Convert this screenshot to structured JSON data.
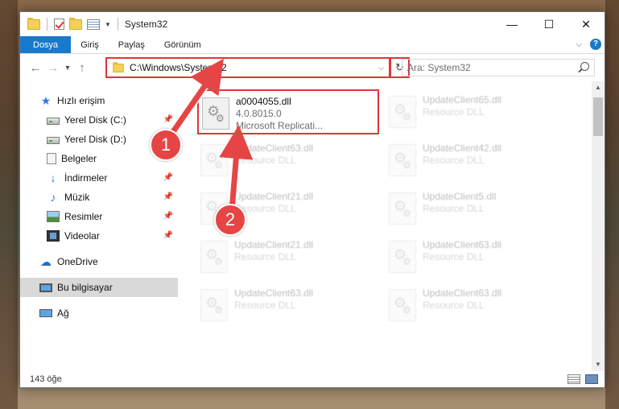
{
  "window": {
    "title": "System32"
  },
  "ribbon": {
    "tabs": [
      "Dosya",
      "Giriş",
      "Paylaş",
      "Görünüm"
    ]
  },
  "address": {
    "path": "C:\\Windows\\System32"
  },
  "search": {
    "placeholder": "Ara: System32"
  },
  "nav": {
    "quick_access": "Hızlı erişim",
    "items": [
      {
        "label": "Yerel Disk (C:)",
        "icon": "drive-icon",
        "pinned": true
      },
      {
        "label": "Yerel Disk (D:)",
        "icon": "drive-icon",
        "pinned": false
      },
      {
        "label": "Belgeler",
        "icon": "documents-icon",
        "pinned": true
      },
      {
        "label": "İndirmeler",
        "icon": "downloads-icon",
        "pinned": true
      },
      {
        "label": "Müzik",
        "icon": "music-icon",
        "pinned": true
      },
      {
        "label": "Resimler",
        "icon": "pictures-icon",
        "pinned": true
      },
      {
        "label": "Videolar",
        "icon": "videos-icon",
        "pinned": true
      }
    ],
    "onedrive": "OneDrive",
    "this_pc": "Bu bilgisayar",
    "network": "Ağ"
  },
  "files": {
    "highlighted": {
      "name": "a0004055.dll",
      "version": "4.0.8015.0",
      "description": "Microsoft Replicati..."
    },
    "others": [
      {
        "name": "UpdateClient65.dll",
        "description": "Resource DLL"
      },
      {
        "name": "UpdateClient63.dll",
        "description": "Resource DLL"
      },
      {
        "name": "UpdateClient42.dll",
        "description": "Resource DLL"
      },
      {
        "name": "UpdateClient21.dll",
        "description": "Resource DLL"
      },
      {
        "name": "UpdateClient5.dll",
        "description": "Resource DLL"
      },
      {
        "name": "UpdateClient21.dll",
        "description": "Resource DLL"
      },
      {
        "name": "UpdateClient63.dll",
        "description": "Resource DLL"
      },
      {
        "name": "UpdateClient63.dll",
        "description": "Resource DLL"
      },
      {
        "name": "UpdateClient63.dll",
        "description": "Resource DLL"
      }
    ]
  },
  "status": {
    "item_count": "143 öğe"
  },
  "annotations": {
    "step1": "1",
    "step2": "2",
    "color": "#e0353a"
  }
}
